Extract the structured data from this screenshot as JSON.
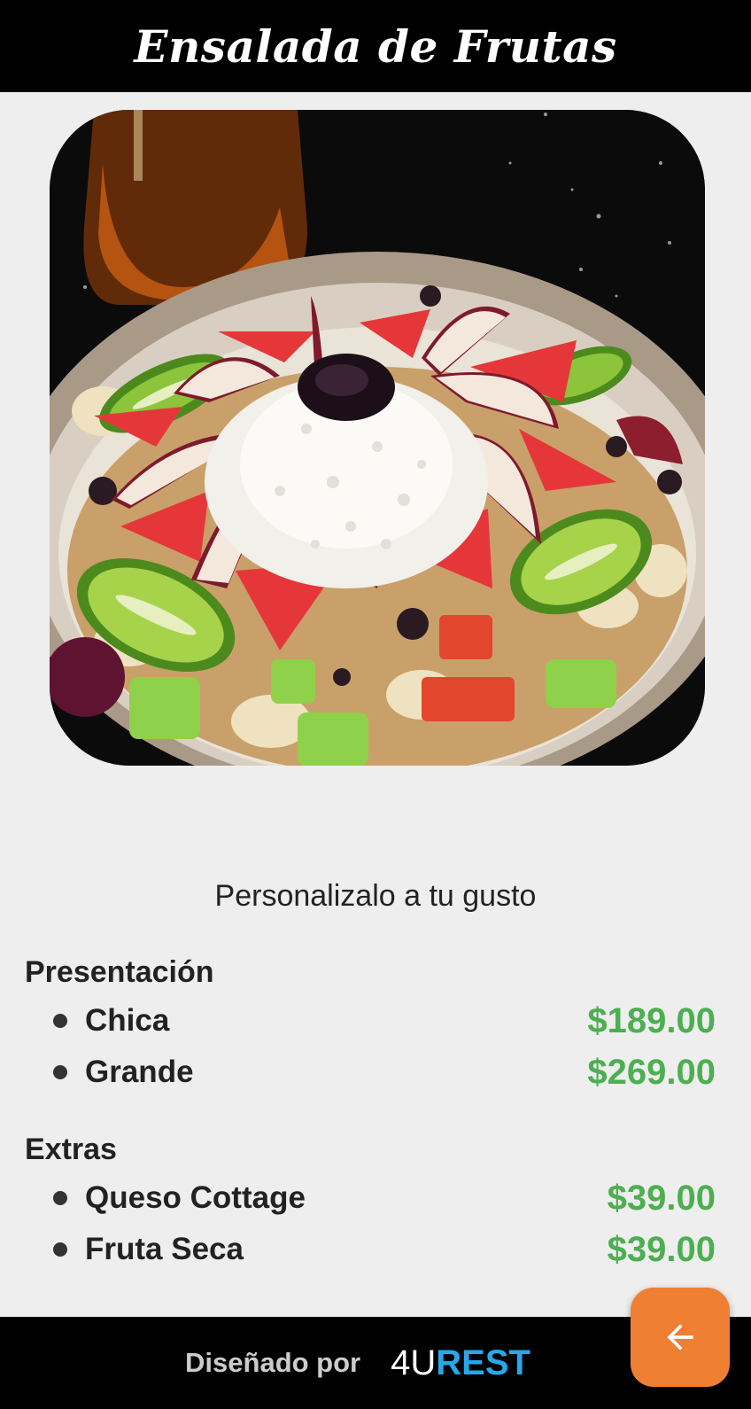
{
  "app_bar": {
    "title": "Ensalada de Frutas"
  },
  "main": {
    "subtitle": "Personalizalo a tu gusto",
    "sections": [
      {
        "title": "Presentación",
        "items": [
          {
            "name": "Chica",
            "price": "$189.00"
          },
          {
            "name": "Grande",
            "price": "$269.00"
          }
        ]
      },
      {
        "title": "Extras",
        "items": [
          {
            "name": "Queso Cottage",
            "price": "$39.00"
          },
          {
            "name": "Fruta Seca",
            "price": "$39.00"
          }
        ]
      }
    ]
  },
  "footer": {
    "designed_by": "Diseñado por",
    "brand_prefix": "4U",
    "brand_suffix": "REST"
  },
  "fab": {
    "icon": "arrow-back-icon"
  },
  "colors": {
    "price": "#4caf50",
    "fab": "#ef7f32",
    "bars": "#000000",
    "brand": "#2aa7e8"
  }
}
